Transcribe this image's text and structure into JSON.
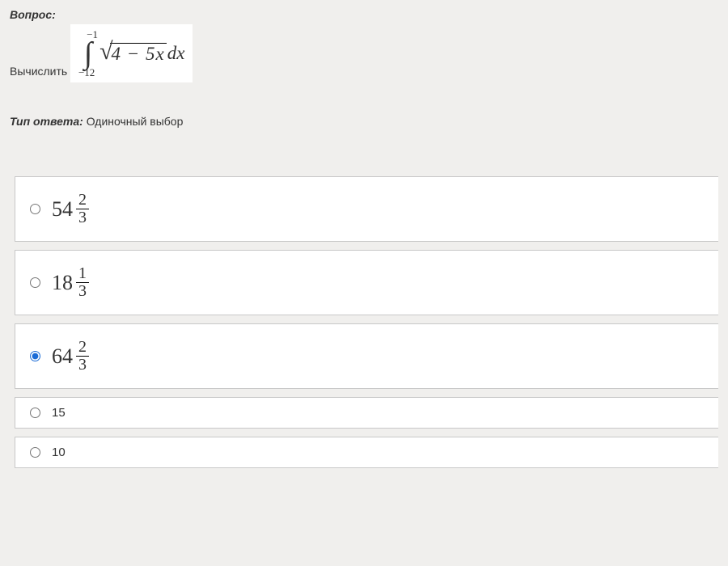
{
  "question": {
    "label": "Вопрос:",
    "compute_prefix": "Вычислить",
    "integral": {
      "upper": "−1",
      "lower": "−12",
      "symbol": "∫",
      "surd": "√",
      "radicand": "4 − 5x",
      "dx": "dx"
    }
  },
  "answer_type": {
    "label": "Тип ответа:",
    "value": "Одиночный выбор"
  },
  "options": [
    {
      "whole": "54",
      "num": "2",
      "den": "3",
      "selected": false,
      "type": "fraction"
    },
    {
      "whole": "18",
      "num": "1",
      "den": "3",
      "selected": false,
      "type": "fraction"
    },
    {
      "whole": "64",
      "num": "2",
      "den": "3",
      "selected": true,
      "type": "fraction"
    },
    {
      "text": "15",
      "selected": false,
      "type": "plain"
    },
    {
      "text": "10",
      "selected": false,
      "type": "plain"
    }
  ]
}
